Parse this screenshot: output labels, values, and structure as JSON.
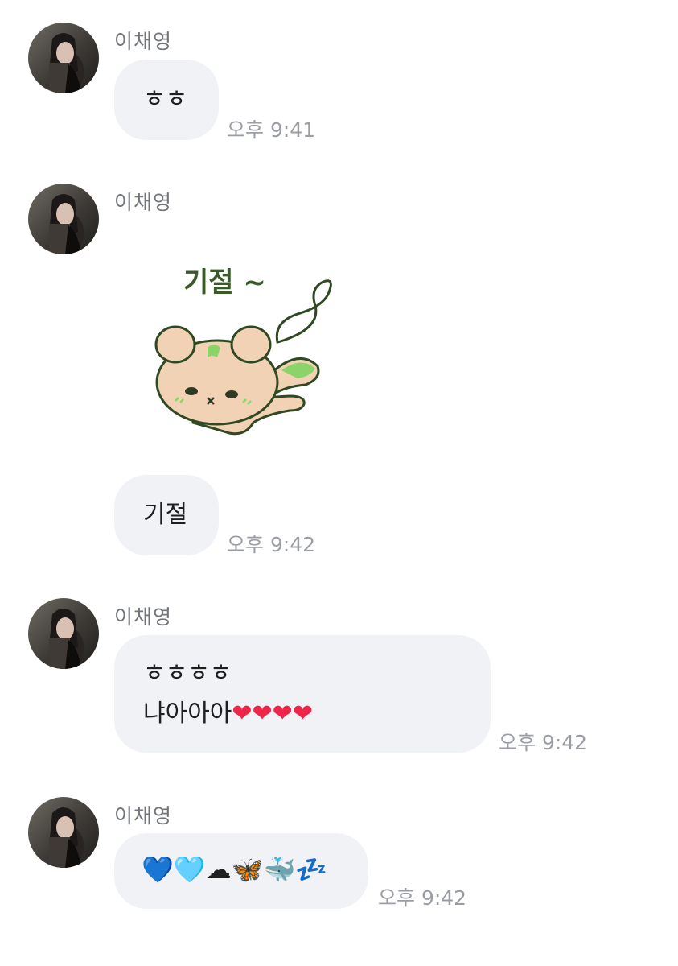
{
  "messages": [
    {
      "sender": "이채영",
      "text": "ㅎㅎ",
      "time": "오후 9:41"
    },
    {
      "sender": "이채영",
      "sticker_text": "기절 ~",
      "text": "기절",
      "time": "오후 9:42"
    },
    {
      "sender": "이채영",
      "line1": "ㅎㅎㅎㅎ",
      "line2": "냐아아아",
      "hearts": "❤❤❤❤",
      "time": "오후 9:42"
    },
    {
      "sender": "이채영",
      "emojis": "💙🩵☁🦋🐳💤",
      "time": "오후 9:42"
    }
  ],
  "colors": {
    "bubble": "#f1f2f6",
    "sender": "#727579",
    "time": "#9a9da3",
    "heart": "#ee2448"
  }
}
